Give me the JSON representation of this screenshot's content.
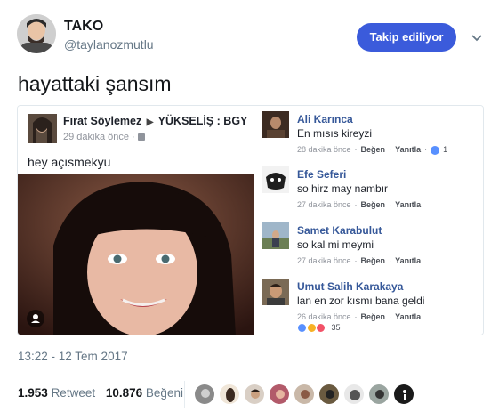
{
  "tweet": {
    "display_name": "TAKO",
    "handle": "@taylanozmutlu",
    "follow_button_label": "Takip ediliyor",
    "text": "hayattaki şansım",
    "timestamp": "13:22 - 12 Tem 2017",
    "retweets_count": "1.953",
    "retweets_label": "Retweet",
    "likes_count": "10.876",
    "likes_label": "Beğeni",
    "accent_color": "#3b5bdb"
  },
  "embedded_post": {
    "author": "Fırat Söylemez",
    "arrow": "▶",
    "group": "YÜKSELİŞ : BGY",
    "time": "29 dakika önce ·",
    "text": "hey açısmekyu"
  },
  "comments": [
    {
      "name": "Ali Karınca",
      "text": "En mısıs kireyzi",
      "time": "28 dakika önce",
      "like": "Beğen",
      "reply": "Yanıtla",
      "reactions": "1"
    },
    {
      "name": "Efe Seferi",
      "text": "so hirz may nambır",
      "time": "27 dakika önce",
      "like": "Beğen",
      "reply": "Yanıtla"
    },
    {
      "name": "Samet Karabulut",
      "text": "so kal mi meymi",
      "time": "27 dakika önce",
      "like": "Beğen",
      "reply": "Yanıtla"
    },
    {
      "name": "Umut Salih Karakaya",
      "text": "lan en zor kısmı bana geldi",
      "time": "26 dakika önce",
      "like": "Beğen",
      "reply": "Yanıtla",
      "reactions": "35"
    }
  ],
  "icons": {
    "chevron": "chevron-down-icon",
    "globe": "globe-icon",
    "profile": "profile-icon",
    "like_reaction": "like-reaction-icon",
    "haha_reaction": "haha-reaction-icon",
    "love_reaction": "love-reaction-icon"
  }
}
